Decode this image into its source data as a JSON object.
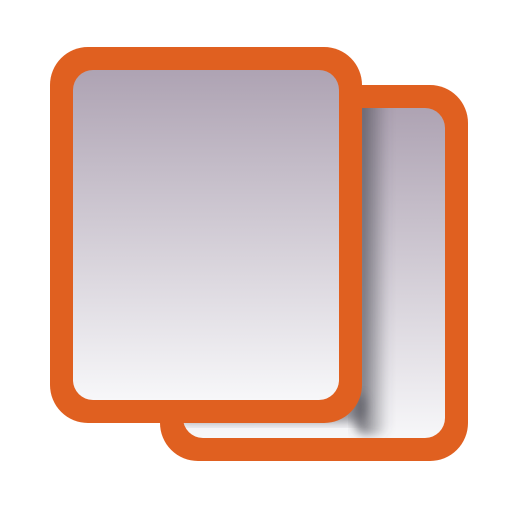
{
  "icon": {
    "name": "copy-documents-icon",
    "colors": {
      "frame": "#e06020",
      "fill_top": "#aea3b3",
      "fill_bottom": "#f7f7f9",
      "shadow": "#4a4a52",
      "background": "#ffffff"
    }
  }
}
